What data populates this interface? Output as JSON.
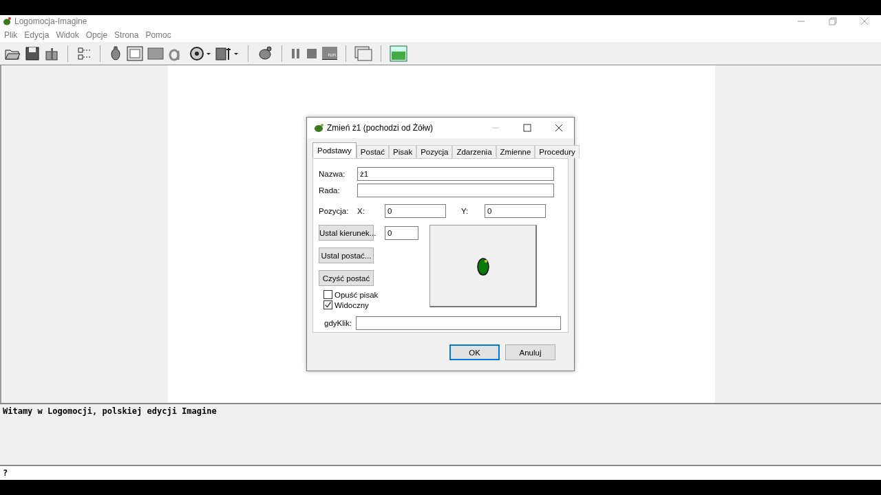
{
  "window": {
    "title": "Logomocja-Imagine"
  },
  "menu": [
    "Plik",
    "Edycja",
    "Widok",
    "Opcje",
    "Strona",
    "Pomoc"
  ],
  "toolbar": {
    "run_label": "run"
  },
  "dialog": {
    "title": "Zmień ż1 (pochodzi od Żółw)",
    "tabs": [
      {
        "label": "Podstawy",
        "selected": true
      },
      {
        "label": "Postać",
        "selected": false
      },
      {
        "label": "Pisak",
        "selected": false
      },
      {
        "label": "Pozycja",
        "selected": false
      },
      {
        "label": "Zdarzenia",
        "selected": false
      },
      {
        "label": "Zmienne",
        "selected": false
      },
      {
        "label": "Procedury",
        "selected": false
      }
    ],
    "name_label": "Nazwa:",
    "name_value": "ż1",
    "hint_label": "Rada:",
    "position_label": "Pozycja:",
    "x_label": "X:",
    "x_value": "0",
    "y_label": "Y:",
    "y_value": "0",
    "heading_button": "Ustal kierunek...",
    "heading_value": "0",
    "shape_button": "Ustal postać...",
    "clear_button": "Czyść postać",
    "checkboxes": [
      {
        "label": "Opuść pisak",
        "checked": false
      },
      {
        "label": "Widoczny",
        "checked": true
      }
    ],
    "click_label": "gdyKlik:",
    "buttons": [
      {
        "label": "OK",
        "default": true
      },
      {
        "label": "Anuluj",
        "default": false
      }
    ]
  },
  "console": {
    "output": "Witamy w Logomocji, polskiej edycji Imagine",
    "prompt": "?"
  }
}
